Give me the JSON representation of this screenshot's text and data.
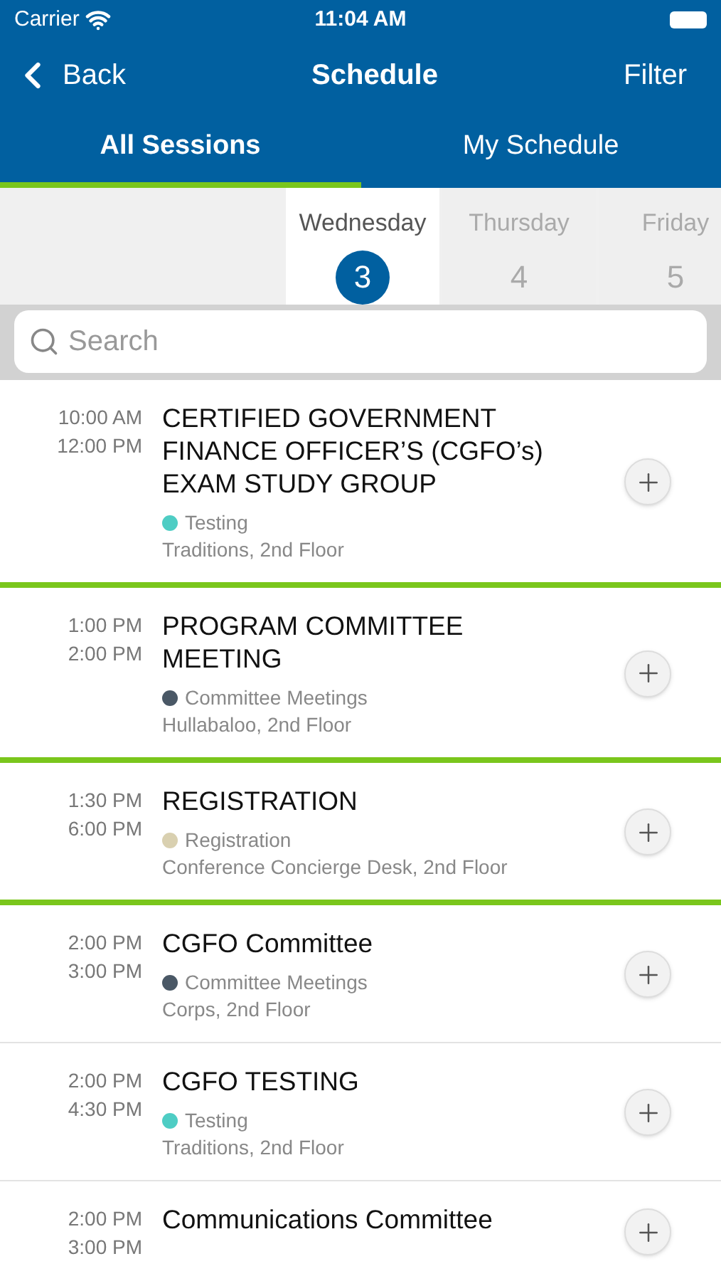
{
  "status_bar": {
    "carrier": "Carrier",
    "time": "11:04 AM"
  },
  "nav": {
    "back": "Back",
    "title": "Schedule",
    "action": "Filter"
  },
  "tabs": [
    {
      "label": "All Sessions",
      "selected": true
    },
    {
      "label": "My Schedule",
      "selected": false
    }
  ],
  "days": [
    {
      "weekday": "Wednesday",
      "date": "3",
      "selected": true
    },
    {
      "weekday": "Thursday",
      "date": "4",
      "selected": false
    },
    {
      "weekday": "Friday",
      "date": "5",
      "selected": false
    }
  ],
  "search": {
    "placeholder": "Search"
  },
  "sessions": [
    {
      "start": "10:00 AM",
      "end": "12:00 PM",
      "title": "CERTIFIED GOVERNMENT FINANCE OFFICER’S (CGFO’s) EXAM STUDY GROUP",
      "track": "Testing",
      "color": "#4ecdc4",
      "location": "Traditions, 2nd Floor",
      "group_end": true
    },
    {
      "start": "1:00 PM",
      "end": "2:00 PM",
      "title": "PROGRAM COMMITTEE MEETING",
      "track": "Committee Meetings",
      "color": "#4a5866",
      "location": "Hullabaloo, 2nd Floor",
      "group_end": true
    },
    {
      "start": "1:30 PM",
      "end": "6:00 PM",
      "title": "REGISTRATION",
      "track": "Registration",
      "color": "#d9d0b0",
      "location": "Conference Concierge Desk, 2nd Floor",
      "group_end": true
    },
    {
      "start": "2:00 PM",
      "end": "3:00 PM",
      "title": "CGFO Committee",
      "track": "Committee Meetings",
      "color": "#4a5866",
      "location": "Corps, 2nd Floor",
      "group_end": false
    },
    {
      "start": "2:00 PM",
      "end": "4:30 PM",
      "title": "CGFO TESTING",
      "track": "Testing",
      "color": "#4ecdc4",
      "location": "Traditions, 2nd Floor",
      "group_end": false
    },
    {
      "start": "2:00 PM",
      "end": "3:00 PM",
      "title": "Communications Committee"
    }
  ]
}
